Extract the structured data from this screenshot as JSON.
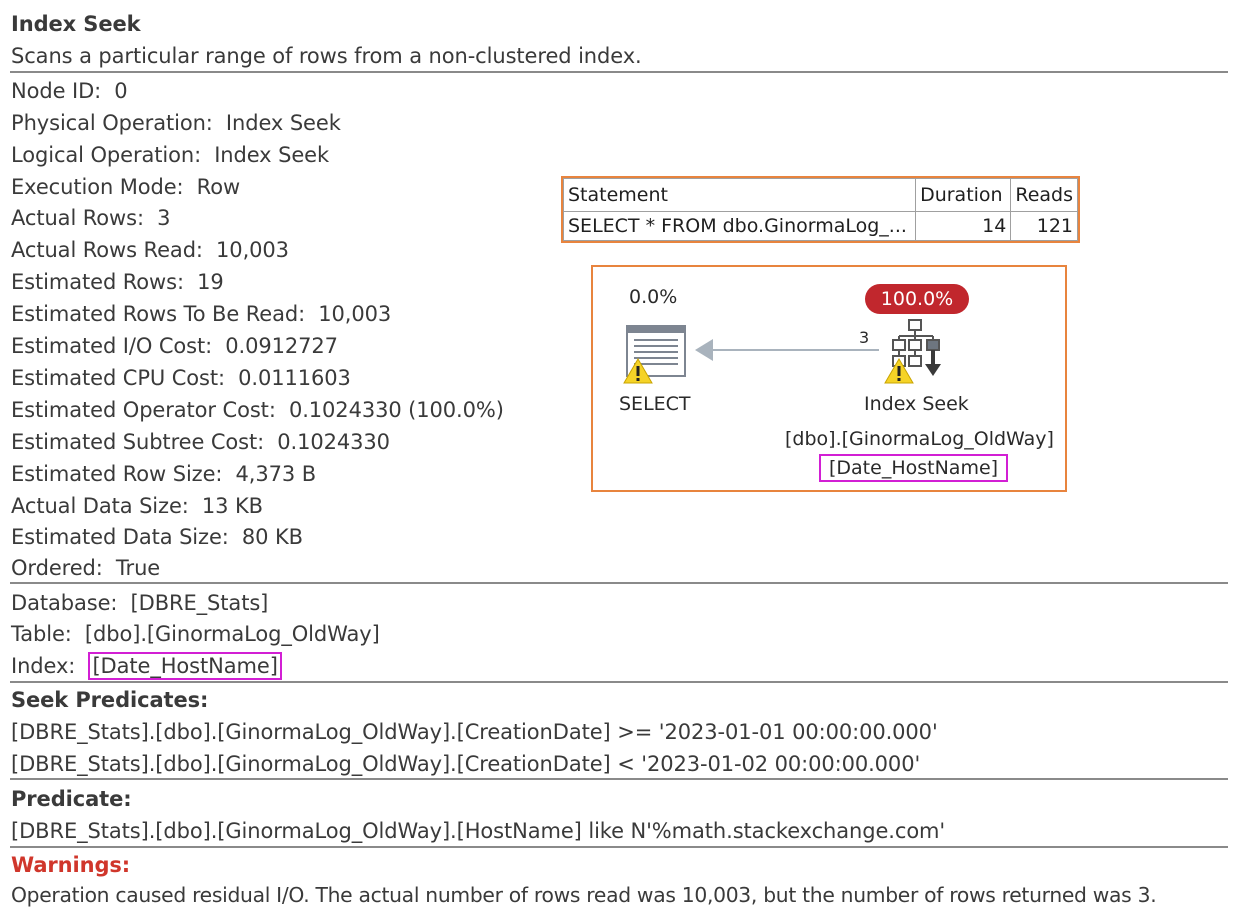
{
  "title": "Index Seek",
  "description": "Scans a particular range of rows from a non-clustered index.",
  "properties": [
    "Node ID:  0",
    "Physical Operation:  Index Seek",
    "Logical Operation:  Index Seek",
    "Execution Mode:  Row",
    "Actual Rows:  3",
    "Actual Rows Read:  10,003",
    "Estimated Rows:  19",
    "Estimated Rows To Be Read:  10,003",
    "Estimated I/O Cost:  0.0912727",
    "Estimated CPU Cost:  0.0111603",
    "Estimated Operator Cost:  0.1024330 (100.0%)",
    "Estimated Subtree Cost:  0.1024330",
    "Estimated Row Size:  4,373 B",
    "Actual Data Size:  13 KB",
    "Estimated Data Size:  80 KB",
    "Ordered:  True"
  ],
  "object": {
    "database": "Database:  [DBRE_Stats]",
    "table": "Table:  [dbo].[GinormaLog_OldWay]",
    "index_label": "Index:  ",
    "index_value": "[Date_HostName]"
  },
  "seek_predicates": {
    "heading": "Seek Predicates:",
    "lines": [
      "[DBRE_Stats].[dbo].[GinormaLog_OldWay].[CreationDate] >= '2023-01-01 00:00:00.000'",
      "[DBRE_Stats].[dbo].[GinormaLog_OldWay].[CreationDate] < '2023-01-02 00:00:00.000'"
    ]
  },
  "predicate": {
    "heading": "Predicate:",
    "line": "[DBRE_Stats].[dbo].[GinormaLog_OldWay].[HostName] like N'%math.stackexchange.com'"
  },
  "warnings": {
    "heading": "Warnings:",
    "line": "Operation caused residual I/O. The actual number of rows read was 10,003, but the number of rows returned was 3."
  },
  "statement_grid": {
    "headers": [
      "Statement",
      "Duration",
      "Reads"
    ],
    "row": [
      "SELECT * FROM dbo.GinormaLog_...",
      "14",
      "121"
    ]
  },
  "plan": {
    "select_cost": "0.0%",
    "select_label": "SELECT",
    "seek_cost": "100.0%",
    "arrow_rows": "3",
    "seek_label": "Index Seek",
    "seek_object": "[dbo].[GinormaLog_OldWay]",
    "seek_index": "[Date_HostName]",
    "icons": [
      "select-icon",
      "index-seek-icon",
      "warning-icon"
    ],
    "colors": {
      "badge": "#c1272d",
      "highlight": "#d21fd4",
      "frame": "#e8843e",
      "warning": "#f5d327"
    }
  }
}
